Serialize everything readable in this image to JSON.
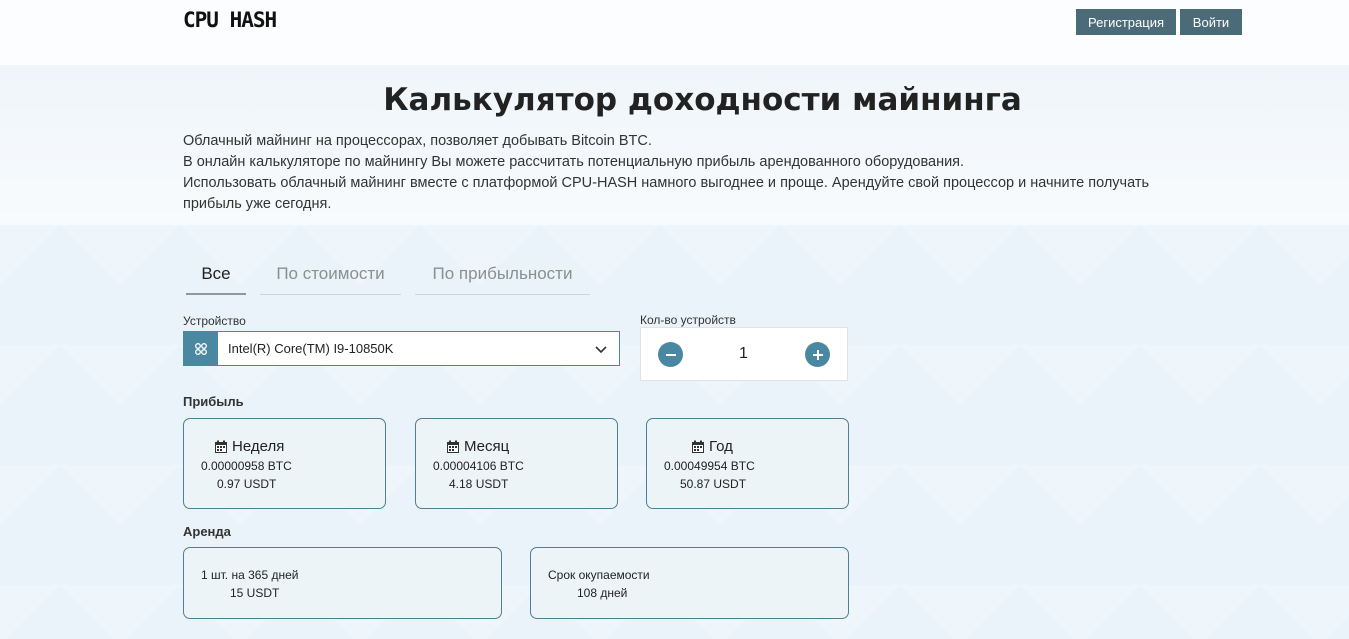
{
  "header": {
    "logo": "CPU HASH",
    "register_label": "Регистрация",
    "login_label": "Войти"
  },
  "hero": {
    "title": "Калькулятор доходности майнинга",
    "lines": [
      "Облачный майнинг на процессорах, позволяет добывать Bitcoin BTC.",
      "В онлайн калькуляторе по майнингу Вы можете рассчитать потенциальную прибыль арендованного оборудования.",
      "Использовать облачный майнинг вместе с платформой CPU-HASH намного выгоднее и проще. Арендуйте свой процессор и начните получать",
      "прибыль уже сегодня."
    ]
  },
  "tabs": [
    {
      "label": "Все",
      "active": true
    },
    {
      "label": "По стоимости",
      "active": false
    },
    {
      "label": "По прибыльности",
      "active": false
    }
  ],
  "device": {
    "label": "Устройство",
    "value": "Intel(R) Core(TM) I9-10850K",
    "icon": "chip-icon"
  },
  "quantity": {
    "label": "Кол-во устройств",
    "value": "1"
  },
  "profit": {
    "label": "Прибыль",
    "cards": [
      {
        "period": "Неделя",
        "btc": "0.00000958 BTC",
        "usdt": "0.97 USDT"
      },
      {
        "period": "Месяц",
        "btc": "0.00004106 BTC",
        "usdt": "4.18 USDT"
      },
      {
        "period": "Год",
        "btc": "0.00049954 BTC",
        "usdt": "50.87 USDT"
      }
    ]
  },
  "rent": {
    "label": "Аренда",
    "cards": [
      {
        "line1": "1 шт. на 365 дней",
        "line2": "15 USDT"
      },
      {
        "line1": "Срок окупаемости",
        "line2": "108 дней"
      }
    ]
  },
  "colors": {
    "accent": "#4a87a0",
    "header_button": "#4c6b78",
    "card_border": "#4f7f92"
  }
}
